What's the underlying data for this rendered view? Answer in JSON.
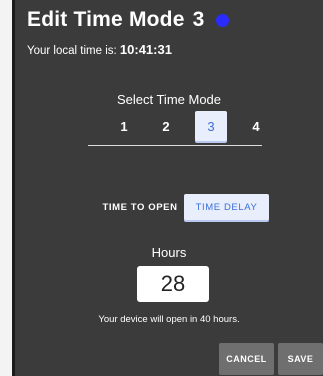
{
  "dialog": {
    "title": "Edit Time Mode",
    "mode_number": "3",
    "status_dot_color": "#2b2bff",
    "local_time_label": "Your local time is:",
    "local_time_value": "10:41:31",
    "select_mode_label": "Select Time Mode",
    "modes": [
      "1",
      "2",
      "3",
      "4"
    ],
    "selected_mode": "3",
    "options": {
      "open_label": "TIME TO OPEN",
      "delay_label": "TIME DELAY",
      "selected": "TIME DELAY"
    },
    "hours_label": "Hours",
    "hours_value": "28",
    "open_note": "Your device will open in 40 hours.",
    "cancel_label": "CANCEL",
    "save_label": "SAVE"
  },
  "colors": {
    "dialog_bg": "#3b3b3b",
    "accent": "#3b6fd8",
    "active_bg": "#e8eefc",
    "button_bg": "#6f6f6f"
  }
}
